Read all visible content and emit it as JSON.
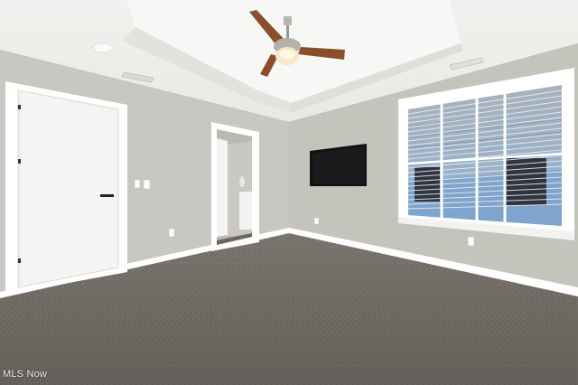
{
  "watermark": {
    "text": "MLS Now"
  },
  "colors": {
    "ceiling": "#f4f4f2",
    "ceiling_inner": "#f8f8f6",
    "wall_left": "#c9c8c2",
    "wall_back": "#c3c2bb",
    "wall_right": "#c6c5be",
    "carpet": "#7b766f",
    "trim": "#ffffff",
    "door": "#f6f6f4",
    "tv": "#111111",
    "fan_blade": "#8a4f2a",
    "window_glass": "#9fb6cc"
  },
  "icons": [
    "ceiling-fan-icon",
    "door-handle-icon",
    "light-switch-icon",
    "outlet-icon",
    "smoke-detector-icon",
    "air-vent-icon"
  ]
}
